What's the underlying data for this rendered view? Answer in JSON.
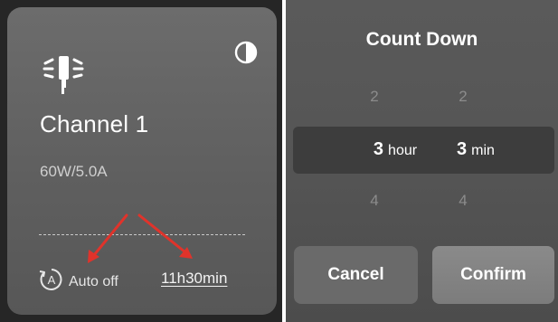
{
  "channel_card": {
    "icon": "lamp-icon",
    "theme_icon": "half-circle-icon",
    "title": "Channel 1",
    "spec": "60W/5.0A",
    "auto_off": {
      "icon": "auto-a-icon",
      "icon_letter": "A",
      "label": "Auto off"
    },
    "timer": "11h30min"
  },
  "annotation": {
    "arrow_color": "#e0332b"
  },
  "count_down": {
    "title": "Count Down",
    "hour": {
      "above": "2",
      "selected": "3",
      "unit": "hour",
      "below": "4"
    },
    "minute": {
      "above": "2",
      "selected": "3",
      "unit": "min",
      "below": "4"
    },
    "cancel_label": "Cancel",
    "confirm_label": "Confirm"
  }
}
